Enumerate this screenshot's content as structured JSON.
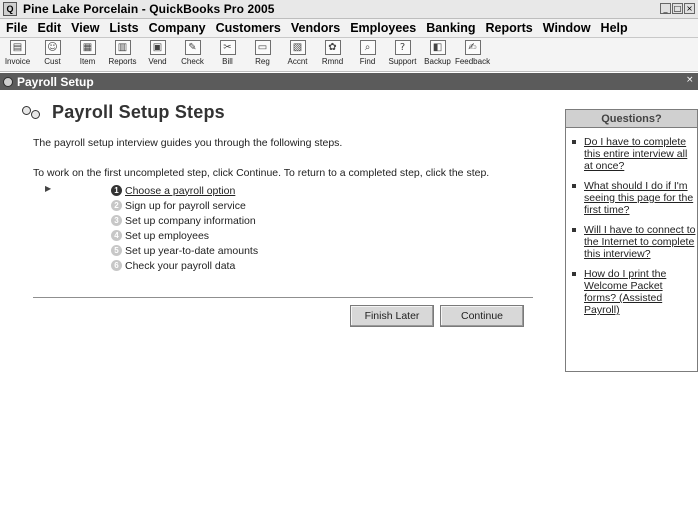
{
  "window": {
    "title": "Pine Lake Porcelain - QuickBooks Pro 2005",
    "buttons": [
      "_",
      "□",
      "×"
    ]
  },
  "menu": [
    "File",
    "Edit",
    "View",
    "Lists",
    "Company",
    "Customers",
    "Vendors",
    "Employees",
    "Banking",
    "Reports",
    "Window",
    "Help"
  ],
  "toolbar": [
    {
      "label": "Invoice",
      "icon": "invoice-icon",
      "glyph": "▤"
    },
    {
      "label": "Cust",
      "icon": "customer-icon",
      "glyph": "☺"
    },
    {
      "label": "Item",
      "icon": "item-icon",
      "glyph": "▦"
    },
    {
      "label": "Reports",
      "icon": "reports-icon",
      "glyph": "▥"
    },
    {
      "label": "Vend",
      "icon": "vendor-icon",
      "glyph": "▣"
    },
    {
      "label": "Check",
      "icon": "check-icon",
      "glyph": "✎"
    },
    {
      "label": "Bill",
      "icon": "bill-icon",
      "glyph": "✂"
    },
    {
      "label": "Reg",
      "icon": "register-icon",
      "glyph": "▭"
    },
    {
      "label": "Accnt",
      "icon": "account-icon",
      "glyph": "▧"
    },
    {
      "label": "Rmnd",
      "icon": "reminder-icon",
      "glyph": "✿"
    },
    {
      "label": "Find",
      "icon": "find-icon",
      "glyph": "⌕"
    },
    {
      "label": "Support",
      "icon": "support-icon",
      "glyph": "?"
    },
    {
      "label": "Backup",
      "icon": "backup-icon",
      "glyph": "◧"
    },
    {
      "label": "Feedback",
      "icon": "feedback-icon",
      "glyph": "✍"
    }
  ],
  "panel": {
    "title": "Payroll Setup",
    "heading": "Payroll Setup Steps",
    "intro": "The payroll setup interview guides you through the following steps.",
    "instruction": "To work on the first uncompleted step, click Continue. To return to a completed step, click the step.",
    "steps": [
      {
        "num": "1",
        "text": "Choose a payroll option"
      },
      {
        "num": "2",
        "text": "Sign up for payroll service"
      },
      {
        "num": "3",
        "text": "Set up company information"
      },
      {
        "num": "4",
        "text": "Set up employees"
      },
      {
        "num": "5",
        "text": "Set up year-to-date amounts"
      },
      {
        "num": "6",
        "text": "Check your payroll data"
      }
    ],
    "finish_label": "Finish Later",
    "continue_label": "Continue"
  },
  "questions": {
    "title": "Questions?",
    "items": [
      "Do I have to complete this entire interview all at once?",
      "What should I do if I'm seeing this page for the first time?",
      "Will I have to connect to the Internet to complete this interview?",
      "How do I print the Welcome Packet forms? (Assisted Payroll)"
    ]
  }
}
